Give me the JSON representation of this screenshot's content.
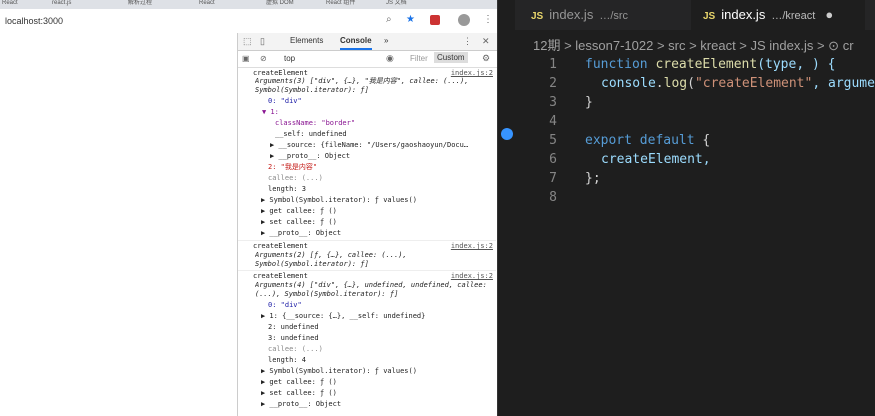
{
  "browser": {
    "tabs": [
      "React",
      "react.js",
      "解析过程",
      "React",
      "虚拟 DOM",
      "React 组件",
      "JS 文档"
    ],
    "url": "localhost:3000"
  },
  "devtools": {
    "tabs": [
      "Elements",
      "Console",
      "»"
    ],
    "context": "top",
    "filter_placeholder": "Filter",
    "levels": "Custom",
    "lines": [
      "createElement",
      "Arguments(3) [\"div\", {…}, \"我是内容\", callee: (...), Symbol(Symbol.iterator): ƒ]",
      "0: \"div\"",
      "▼ 1:",
      "className: \"border\"",
      "__self: undefined",
      "▶ __source: {fileName: \"/Users/gaoshaoyun/Docu…",
      "▶ __proto__: Object",
      "2: \"我是内容\"",
      "callee: (...)",
      "length: 3",
      "▶ Symbol(Symbol.iterator): ƒ values()",
      "▶ get callee: ƒ ()",
      "▶ set callee: ƒ ()",
      "▶ __proto__: Object",
      "createElement",
      "Arguments(2) [ƒ, {…}, callee: (...), Symbol(Symbol.iterator): ƒ]",
      "createElement",
      "Arguments(4) [\"div\", {…}, undefined, undefined, callee: (...), Symbol(Symbol.iterator): ƒ]",
      "0: \"div\"",
      "▶ 1: {__source: {…}, __self: undefined}",
      "2: undefined",
      "3: undefined",
      "callee: (...)",
      "length: 4",
      "▶ Symbol(Symbol.iterator): ƒ values()",
      "▶ get callee: ƒ ()",
      "▶ set callee: ƒ ()",
      "▶ __proto__: Object"
    ],
    "source_link": "index.js:2"
  },
  "editor": {
    "tabs": [
      {
        "badge": "JS",
        "name": "index.js",
        "path": "…/src"
      },
      {
        "badge": "JS",
        "name": "index.js",
        "path": "…/kreact"
      }
    ],
    "breadcrumb": "12期 > lesson7-1022 > src > kreact > JS index.js > ⊙ cr",
    "line_numbers": [
      "1",
      "2",
      "3",
      "4",
      "5",
      "6",
      "7",
      "8"
    ],
    "code": {
      "l1_kw": "function",
      "l1_fn": "createElement",
      "l1_rest": "(type, ) {",
      "l2_obj": "console",
      "l2_fn": "log",
      "l2_str": "\"createElement\"",
      "l2_rest": ", argumen",
      "l3": "}",
      "l5_kw": "export default",
      "l5_rest": " {",
      "l6": "createElement,",
      "l7": "};"
    }
  }
}
